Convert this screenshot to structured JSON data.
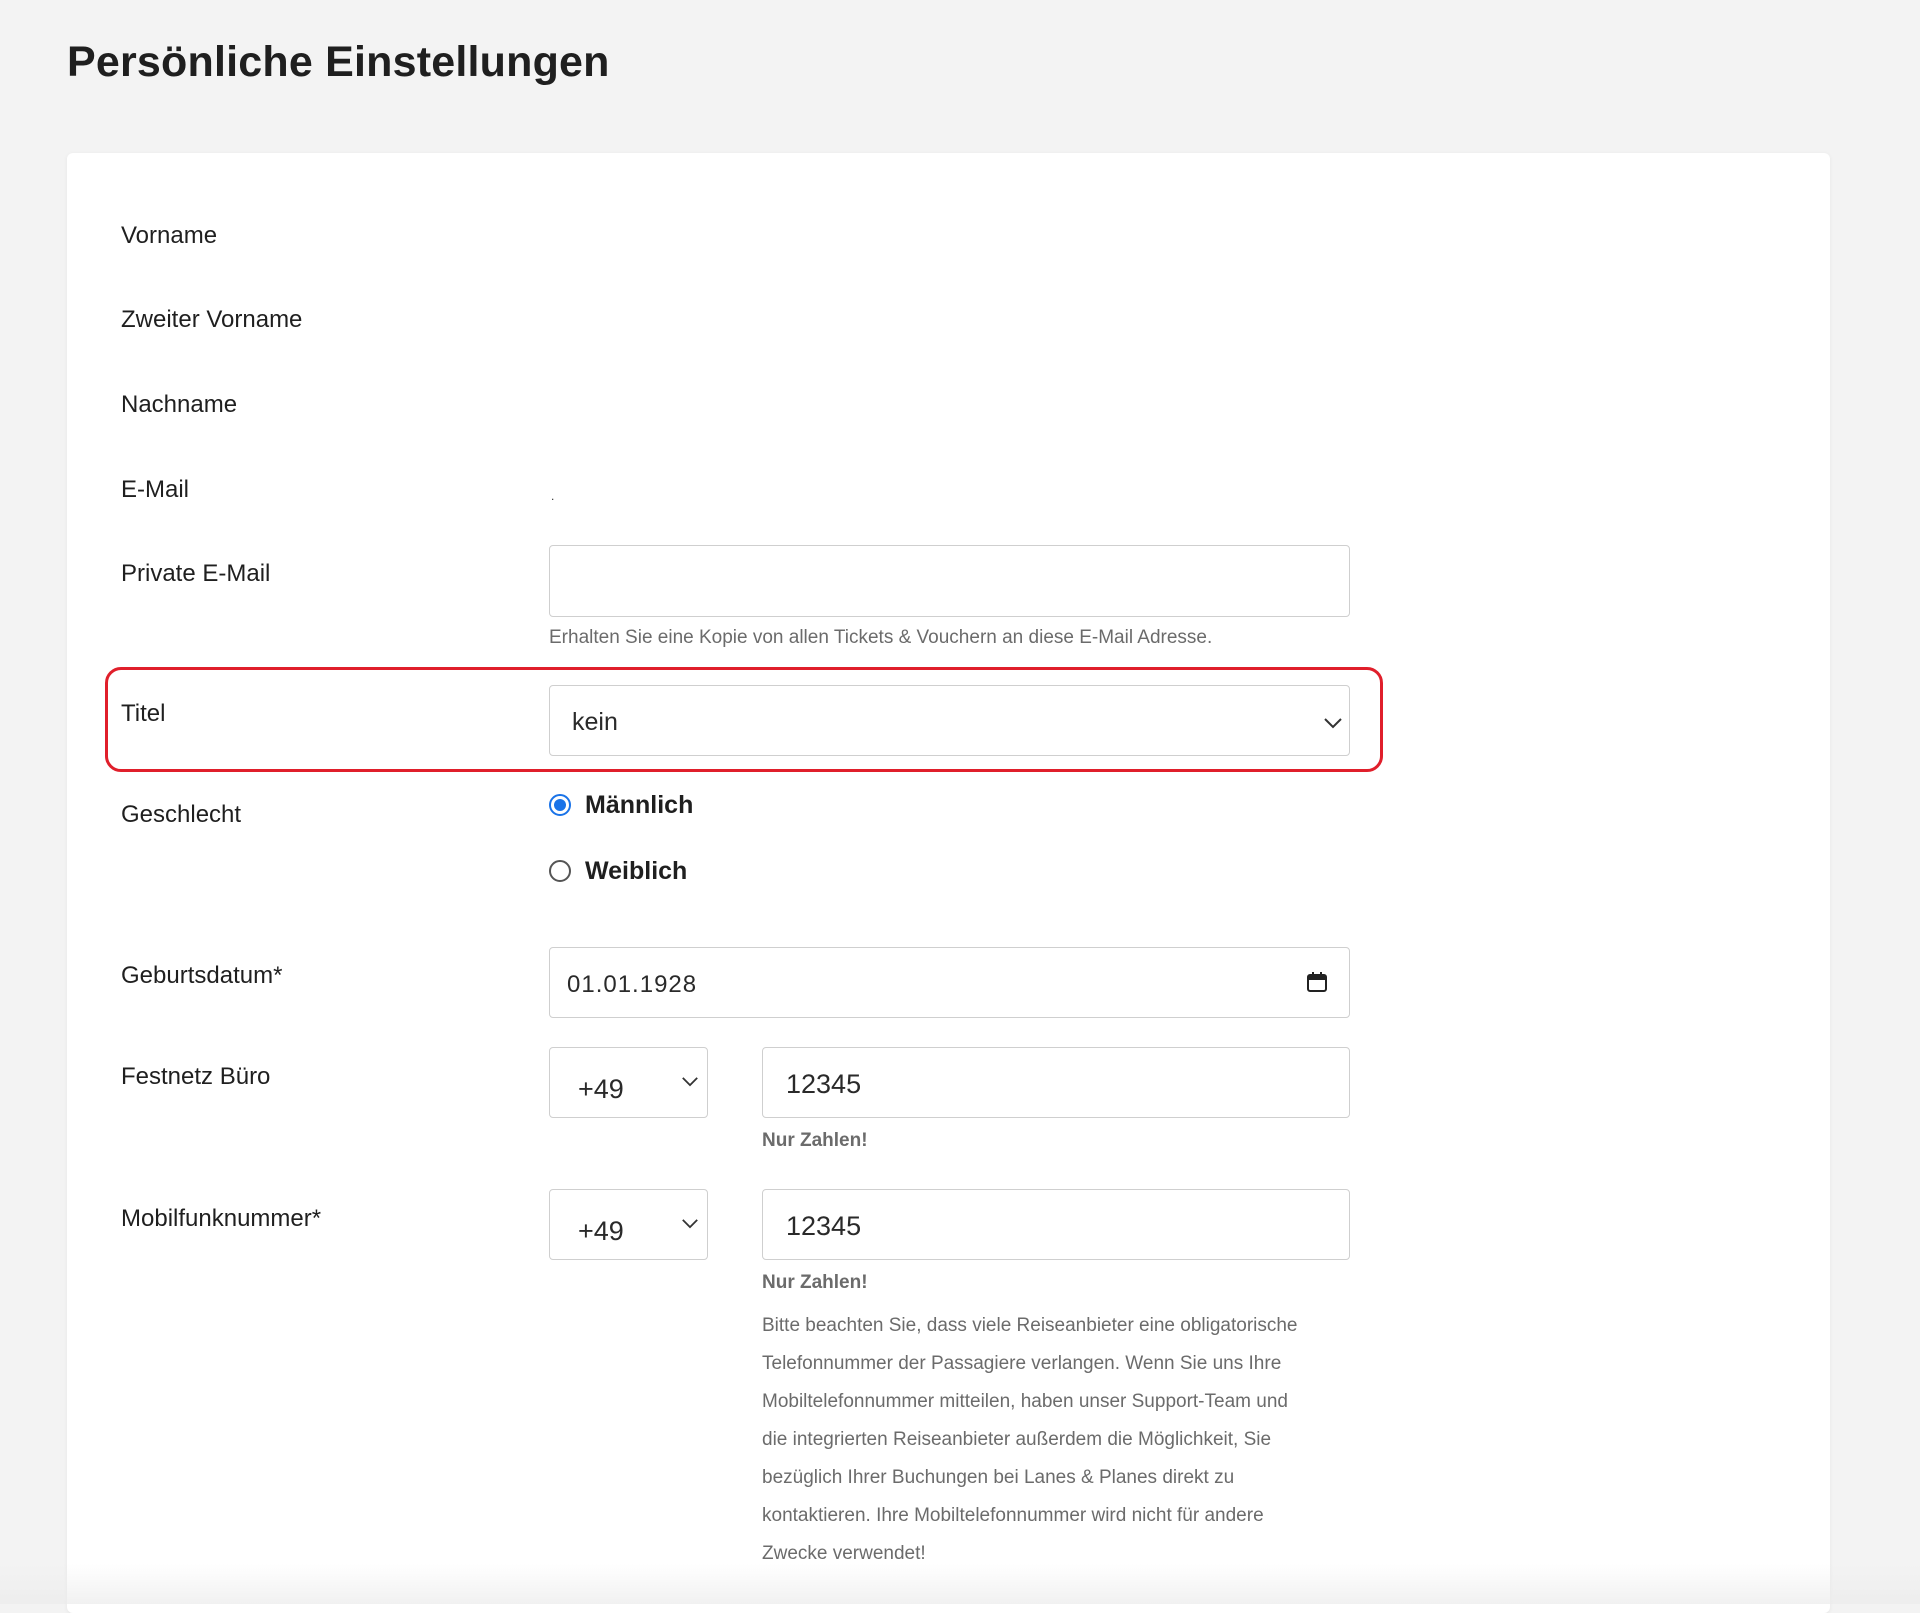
{
  "page": {
    "title": "Persönliche Einstellungen"
  },
  "form": {
    "vorname": {
      "label": "Vorname"
    },
    "zweiter_vorname": {
      "label": "Zweiter Vorname"
    },
    "nachname": {
      "label": "Nachname"
    },
    "email": {
      "label": "E-Mail",
      "value": "."
    },
    "private_email": {
      "label": "Private E-Mail",
      "value": "",
      "help": "Erhalten Sie eine Kopie von allen Tickets & Vouchern an diese E-Mail Adresse."
    },
    "titel": {
      "label": "Titel",
      "selected": "kein"
    },
    "geschlecht": {
      "label": "Geschlecht",
      "options": [
        {
          "label": "Männlich",
          "checked": true
        },
        {
          "label": "Weiblich",
          "checked": false
        }
      ]
    },
    "geburtsdatum": {
      "label": "Geburtsdatum*",
      "value": "01.01.1928"
    },
    "festnetz": {
      "label": "Festnetz Büro",
      "country_code": "+49",
      "number": "12345",
      "hint": "Nur Zahlen!"
    },
    "mobil": {
      "label": "Mobilfunknummer*",
      "country_code": "+49",
      "number": "12345",
      "hint": "Nur Zahlen!",
      "note": "Bitte beachten Sie, dass viele Reiseanbieter eine obligatorische\nTelefonnummer der Passagiere verlangen. Wenn Sie uns Ihre\nMobiltelefonnummer mitteilen, haben unser Support-Team und\ndie integrierten Reiseanbieter außerdem die Möglichkeit, Sie\nbezüglich Ihrer Buchungen bei Lanes & Planes direkt zu\nkontaktieren. Ihre Mobiltelefonnummer wird nicht für andere\nZwecke verwendet!"
    }
  },
  "colors": {
    "highlight": "#e01f2b",
    "radio_accent": "#1a73e8",
    "background": "#f3f3f3"
  },
  "icons": {
    "select": "chevron-down-icon",
    "date": "calendar-icon"
  }
}
